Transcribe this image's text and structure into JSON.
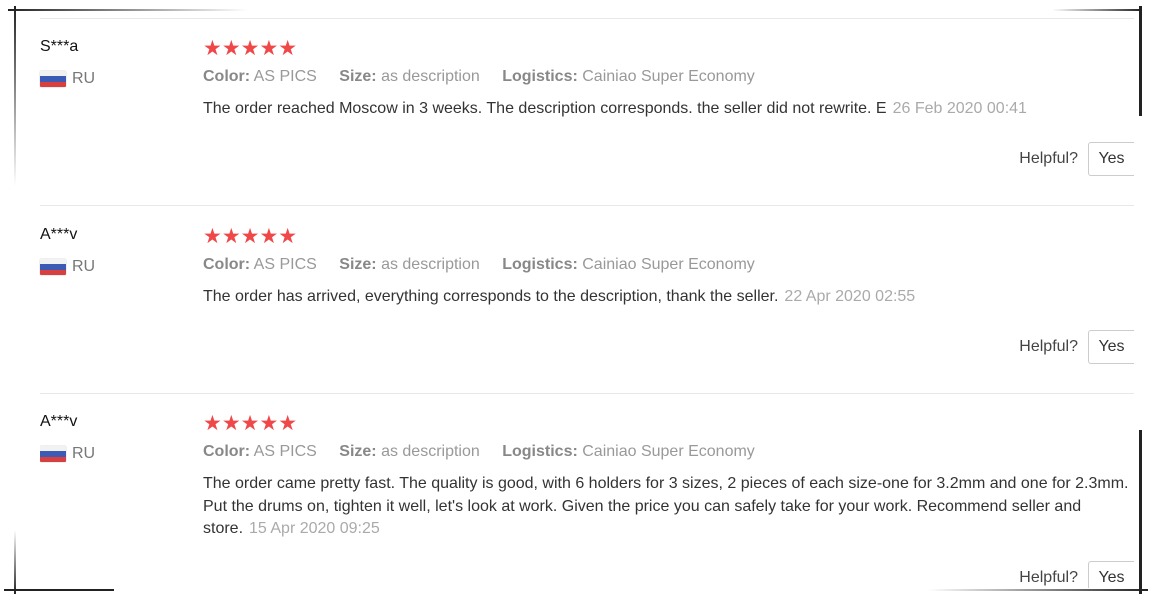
{
  "reviews": [
    {
      "user": "S***a",
      "country": "RU",
      "stars": "★★★★★",
      "color_key": "Color:",
      "color_val": "AS PICS",
      "size_key": "Size:",
      "size_val": "as description",
      "logistics_key": "Logistics:",
      "logistics_val": "Cainiao Super Economy",
      "text": "The order reached Moscow in 3 weeks. The description corresponds. the seller did not rewrite. E",
      "date": "26 Feb 2020 00:41",
      "helpful_label": "Helpful?",
      "yes_label": "Yes"
    },
    {
      "user": "A***v",
      "country": "RU",
      "stars": "★★★★★",
      "color_key": "Color:",
      "color_val": "AS PICS",
      "size_key": "Size:",
      "size_val": "as description",
      "logistics_key": "Logistics:",
      "logistics_val": "Cainiao Super Economy",
      "text": "The order has arrived, everything corresponds to the description, thank the seller.",
      "date": "22 Apr 2020 02:55",
      "helpful_label": "Helpful?",
      "yes_label": "Yes"
    },
    {
      "user": "A***v",
      "country": "RU",
      "stars": "★★★★★",
      "color_key": "Color:",
      "color_val": "AS PICS",
      "size_key": "Size:",
      "size_val": "as description",
      "logistics_key": "Logistics:",
      "logistics_val": "Cainiao Super Economy",
      "text": "The order came pretty fast. The quality is good, with 6 holders for 3 sizes, 2 pieces of each size-one for 3.2mm and one for 2.3mm. Put the drums on, tighten it well, let's look at work. Given the price you can safely take for your work. Recommend seller and store.",
      "date": "15 Apr 2020 09:25",
      "helpful_label": "Helpful?",
      "yes_label": "Yes"
    }
  ],
  "colors": {
    "star": "#f04848",
    "flag_white": "#f2f2f2",
    "flag_blue": "#3b5bb5",
    "flag_red": "#d84040"
  }
}
